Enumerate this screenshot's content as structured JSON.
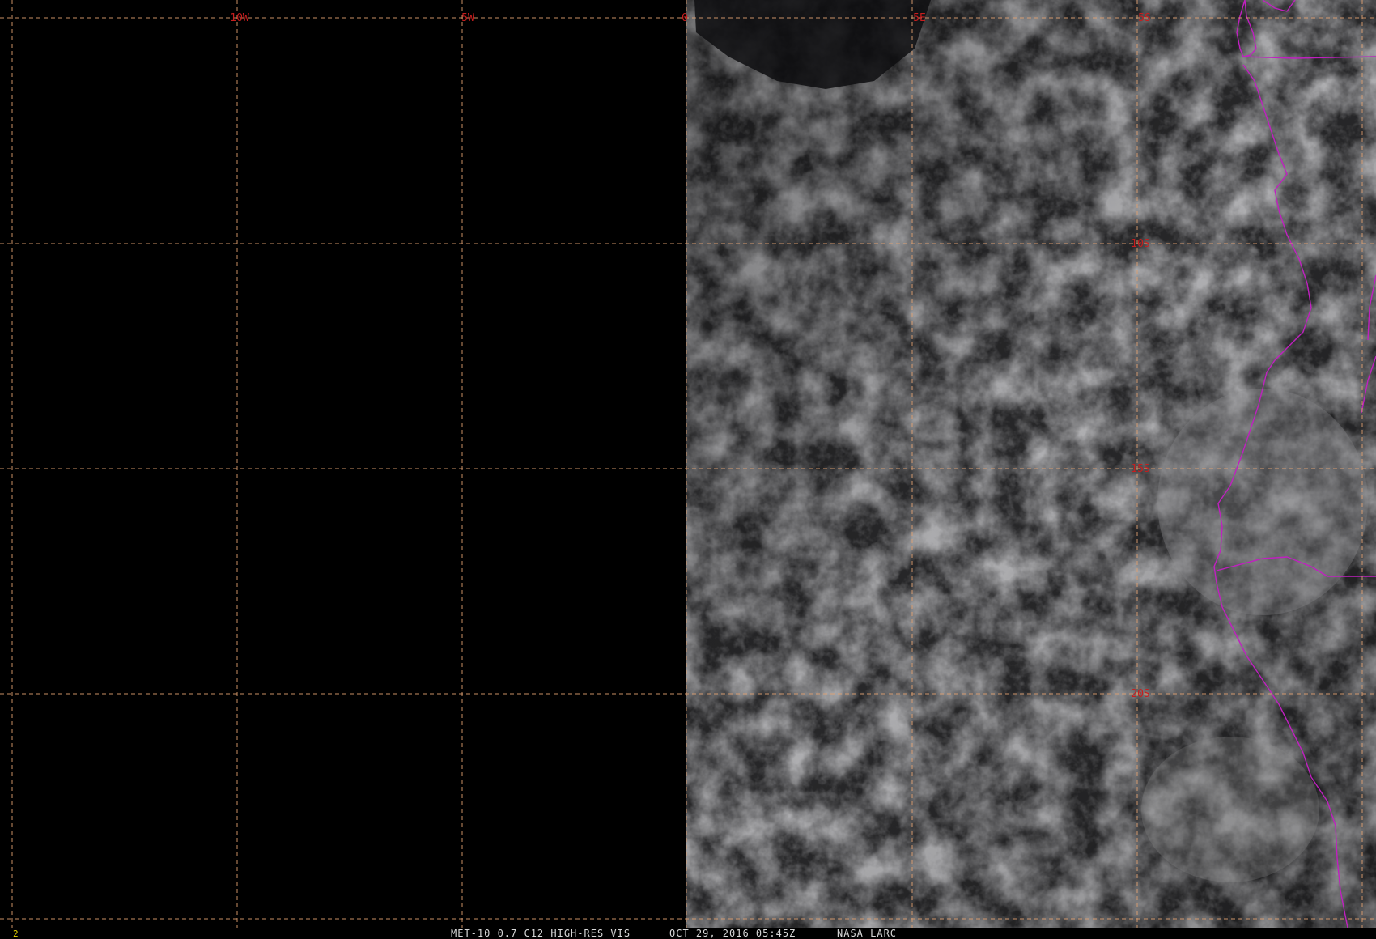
{
  "image": {
    "sensor": "MET-10 0.7 C12 HIGH-RES VIS",
    "datetime": "OCT 29, 2016 05:45Z",
    "source": "NASA LARC",
    "frame_number": "2"
  },
  "grid": {
    "longitude_labels": [
      "10W",
      "5W",
      "0",
      "5E",
      "5S"
    ],
    "latitude_labels": [
      "10S",
      "15S",
      "20S"
    ]
  },
  "colors": {
    "background": "#000000",
    "grid": "#e0a070",
    "grid_label": "#c81e1e",
    "coastline": "#c020c0",
    "footer_text": "#d8d8d8",
    "frame_number": "#e6d200"
  }
}
